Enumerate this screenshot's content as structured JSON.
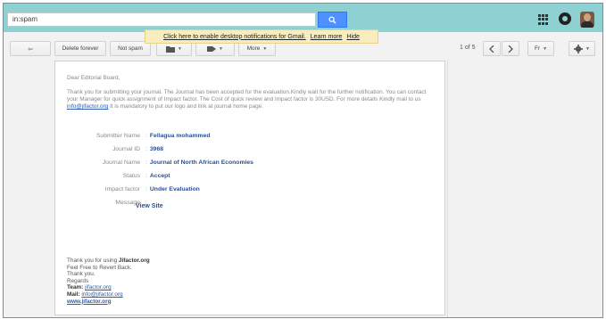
{
  "search": {
    "value": "in:spam",
    "button_icon": "search-icon"
  },
  "notification_bar": {
    "text": "Click here to enable desktop notifications for Gmail.",
    "learn_more": "Learn more",
    "hide": "Hide"
  },
  "header_icons": [
    "apps-grid-icon",
    "notifications-icon",
    "avatar"
  ],
  "toolbar": {
    "back_label": "⇦",
    "delete_forever_label": "Delete forever",
    "not_spam_label": "Not spam",
    "folder_icon": "folder-icon",
    "label_icon": "label-icon",
    "more_label": "More",
    "page_count": "1 of 5",
    "prev_icon": "chevron-left-icon",
    "next_icon": "chevron-right-icon",
    "language_label": "Fr",
    "settings_icon": "gear-icon"
  },
  "email": {
    "greeting": "Dear Editorial Board,",
    "body_before_link": "Thank you for submitting your journal. The Journal has been accepted for the evaluation.Kindly wait for the further notification. You can contact your Manager for quick assignment of Impact factor. The Cost of quick review and Impact factor is 30USD. For more details Kindly mail to us",
    "body_link": "info@jifactor.org",
    "body_after_link": "It is mandatory to put our logo and link at journal home page.",
    "details": [
      {
        "label": "Submitter Name",
        "value": "Fellagua mohammed"
      },
      {
        "label": "Journal ID",
        "value": "3968"
      },
      {
        "label": "Journal Name",
        "value": "Journal of North African Economies"
      },
      {
        "label": "Status",
        "value": "Accept"
      },
      {
        "label": "Impact factor",
        "value": "Under Evaluation"
      },
      {
        "label": "Message",
        "value": ""
      }
    ],
    "view_site": "View Site",
    "signature": {
      "thanks_prefix": "Thank you for using ",
      "thanks_brand": "Jifactor.org",
      "line2": "Feel Free to Revert Back.",
      "line3": "Thank you.",
      "line4": "Regards",
      "team_label": "Team:",
      "team_link": "jifactor.org",
      "mail_label": "Mail:",
      "mail_link": "info@jifactor.org",
      "website": "www.jifactor.org"
    }
  },
  "colors": {
    "header_bg": "#8fd1d3",
    "search_button": "#4d90fe",
    "notification_bg": "#f9edbe",
    "link": "#2a5db0",
    "detail_value": "#2a4f9a"
  }
}
